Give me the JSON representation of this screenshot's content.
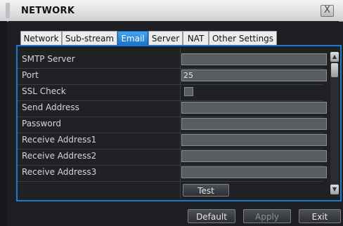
{
  "window": {
    "title": "NETWORK",
    "close_label": "X"
  },
  "tabs": [
    {
      "label": "Network",
      "active": false
    },
    {
      "label": "Sub-stream",
      "active": false
    },
    {
      "label": "Email",
      "active": true
    },
    {
      "label": "Server",
      "active": false
    },
    {
      "label": "NAT",
      "active": false
    },
    {
      "label": "Other Settings",
      "active": false
    }
  ],
  "rows": [
    {
      "label": "SMTP Server",
      "value": ""
    },
    {
      "label": "Port",
      "value": "25"
    },
    {
      "label": "SSL Check",
      "checked": false
    },
    {
      "label": "Send Address",
      "value": ""
    },
    {
      "label": "Password",
      "value": ""
    },
    {
      "label": "Receive Address1",
      "value": ""
    },
    {
      "label": "Receive Address2",
      "value": ""
    },
    {
      "label": "Receive Address3",
      "value": ""
    }
  ],
  "test_button": "Test",
  "footer": {
    "default_label": "Default",
    "apply_label": "Apply",
    "exit_label": "Exit"
  },
  "colors": {
    "accent": "#1a7ad0",
    "active_tab": "#1672c8"
  }
}
